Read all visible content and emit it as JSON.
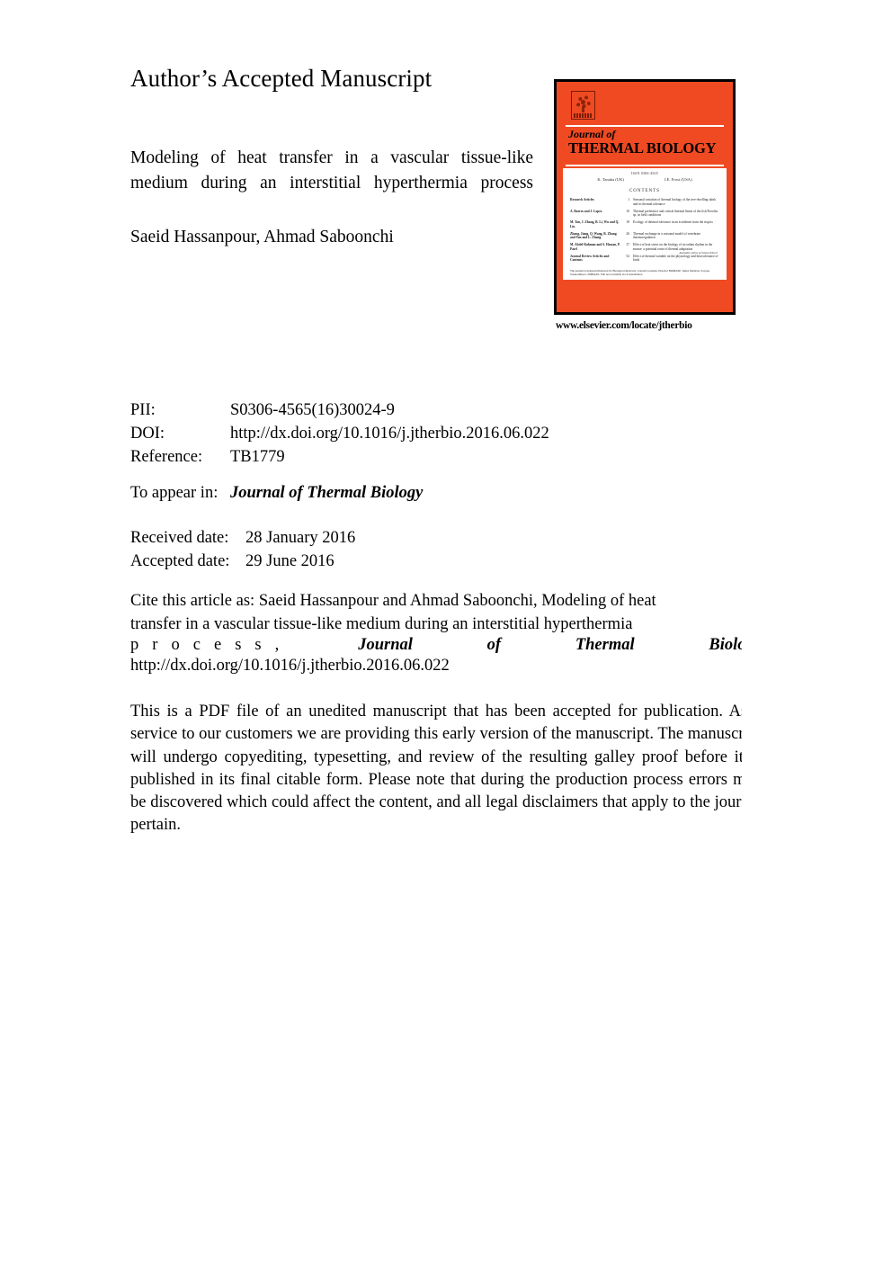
{
  "page": {
    "heading": "Author’s Accepted Manuscript",
    "article_title_line1": "Modeling of heat transfer in a vascular tissue-like",
    "article_title_line2": "medium during an interstitial hyperthermia process",
    "authors": "Saeid Hassanpour, Ahmad Saboonchi"
  },
  "metadata": {
    "pii_label": "PII:",
    "pii_value": "S0306-4565(16)30024-9",
    "doi_label": "DOI:",
    "doi_value": "http://dx.doi.org/10.1016/j.jtherbio.2016.06.022",
    "reference_label": "Reference:",
    "reference_value": "TB1779",
    "to_appear_label": "To appear in:",
    "to_appear_value": "Journal of Thermal Biology",
    "received_label": "Received date:",
    "received_value": "28 January 2016",
    "accepted_label": "Accepted date:",
    "accepted_value": "29 June 2016"
  },
  "citation": {
    "line1": "Cite this article as: Saeid Hassanpour and Ahmad Saboonchi, Modeling of heat",
    "line2": "transfer in a vascular tissue-like medium during an interstitial hyperthermia",
    "spaced_word": "p r o c e s s ,",
    "journal_word1": "Journal",
    "journal_word2": "of",
    "journal_word3": "Thermal",
    "journal_word4": "Biology",
    "doi_url": "http://dx.doi.org/10.1016/j.jtherbio.2016.06.022"
  },
  "disclaimer": {
    "text": "This is a PDF file of an unedited manuscript that has been accepted for publication. As a service to our customers we are providing this early version of the manuscript. The manuscript will undergo copyediting, typesetting, and review of the resulting galley proof before it is published in its final citable form. Please note that during the production process errors may be discovered which could affect the content, and all legal disclaimers that apply to the journal pertain."
  },
  "cover": {
    "accent_color": "#F04A23",
    "publisher_logo": "elsevier-tree-logo",
    "journal_of": "Journal of",
    "journal_name": "THERMAL BIOLOGY",
    "issn": "ISSN 0306-4565",
    "editor_left": "K. Tanaka (UK)",
    "editor_right": "J.E. Frost (USA)",
    "contents_heading": "CONTENTS",
    "toc": [
      {
        "authors": "Research Articles",
        "page": "1",
        "title": "Seasonal variation of thermal biology of the tree-dwelling skink and its thermal tolerance"
      },
      {
        "authors": "A. Barros and J. Lopez",
        "page": "10",
        "title": "Thermal preference and critical thermal limits of the fish Poecilia sp. in field conditions"
      },
      {
        "authors": "M. Tan, J. Zhang, B. Li, Wu and Q. Liu",
        "page": "18",
        "title": "Ecology of thermal tolerance in an ectotherm from the tropics"
      },
      {
        "authors": "Zhang, Jiang, Q. Wang, R. Zhang and Yan and L. Zhang",
        "page": "26",
        "title": "Thermal exchange in a seasonal model of vertebrate thermoregulation"
      },
      {
        "authors": "M. Abdel-Rahman and S. Hassan, P. Patel",
        "page": "37",
        "title": "Effect of heat stress on the biology of circadian rhythm in the mouse: a potential route of thermal adaptation"
      },
      {
        "authors": "Journal Review Articles and Contents",
        "page": "52",
        "title": "Effect of thermal variable on the physiology and heat tolerance of birds"
      }
    ],
    "available_online": "Available online at ScienceDirect",
    "footnote": "The journal is indexed/abstracted in: Biological Abstracts, Current Contents, Elsevier BIOBASE, Index Medicus, Scopus, ScienceDirect, EMBASE. Full text available via ScienceDirect.",
    "url": "www.elsevier.com/locate/jtherbio"
  }
}
